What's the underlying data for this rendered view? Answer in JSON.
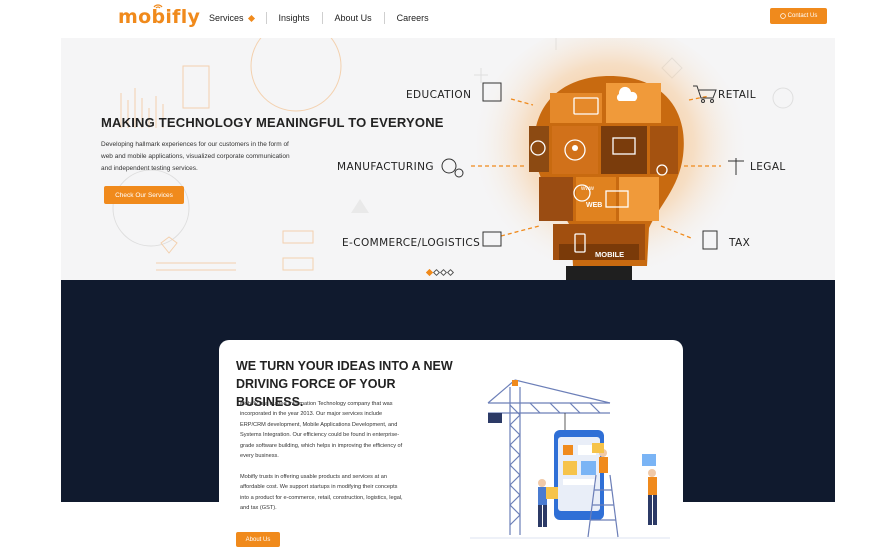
{
  "header": {
    "logo": "mobifly",
    "nav": [
      {
        "label": "Services"
      },
      {
        "label": "Insights"
      },
      {
        "label": "About Us"
      },
      {
        "label": "Careers"
      }
    ],
    "contact_label": "Contact Us"
  },
  "hero": {
    "title": "MAKING TECHNOLOGY MEANINGFUL TO EVERYONE",
    "text": "Developing hallmark experiences for our customers in the form of web and mobile applications, visualized corporate communication and independent testing services.",
    "button": "Check Our Services",
    "categories": {
      "education": "EDUCATION",
      "manufacturing": "MANUFACTURING",
      "ecommerce": "E-COMMERCE/LOGISTICS",
      "retail": "RETAIL",
      "legal": "LEGAL",
      "tax": "TAX"
    },
    "bulb_labels": {
      "web": "WEB",
      "mobile": "MOBILE",
      "www": "www"
    },
    "slides": 4,
    "active_slide": 1
  },
  "about": {
    "title": "WE TURN YOUR IDEAS INTO A NEW DRIVING FORCE OF YOUR BUSINESS.",
    "p1": "Mobifly is a trusted Information Technology company that was incorporated in the year 2013. Our major services include ERP/CRM development, Mobile Applications Development, and Systems Integration. Our efficiency could be found in enterprise-grade software building, which helps in improving the efficiency of every business.",
    "p2": "Mobifly trusts in offering usable products and services at an affordable cost. We support startups in modifying their concepts into a product for e-commerce, retail, construction, logistics, legal, and tax (GST).",
    "button": "About Us"
  },
  "colors": {
    "accent": "#f08a1c",
    "dark": "#101a2e",
    "hero_bg": "#f5f5f6"
  }
}
